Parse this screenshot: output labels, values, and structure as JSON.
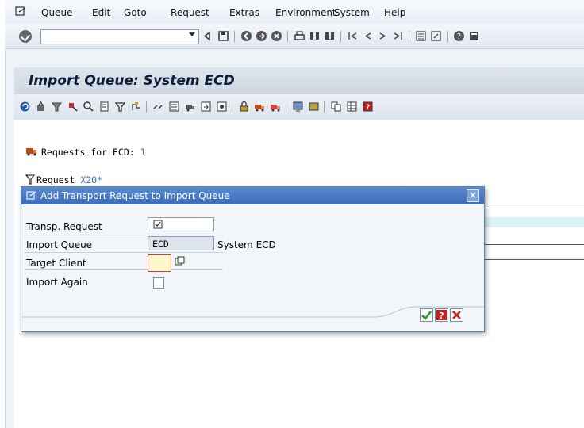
{
  "menubar": {
    "items": [
      {
        "prefix": "",
        "underline": "Q",
        "rest": "ueue"
      },
      {
        "prefix": "",
        "underline": "E",
        "rest": "dit"
      },
      {
        "prefix": "",
        "underline": "G",
        "rest": "oto"
      },
      {
        "prefix": "",
        "underline": "R",
        "rest": "equest"
      },
      {
        "prefix": "Extr",
        "underline": "a",
        "rest": "s"
      },
      {
        "prefix": "En",
        "underline": "v",
        "rest": "ironment"
      },
      {
        "prefix": "S",
        "underline": "y",
        "rest": "stem"
      },
      {
        "prefix": "",
        "underline": "H",
        "rest": "elp"
      }
    ]
  },
  "toolbar": {
    "command_value": ""
  },
  "page": {
    "title": "Import Queue: System ECD"
  },
  "content": {
    "requests_label": "Requests for ECD: ",
    "requests_count": "1",
    "filter_label": "Request ",
    "filter_value": "X20*"
  },
  "dialog": {
    "title": "Add Transport Request to Import Queue",
    "fields": [
      {
        "label": "Transp. Request",
        "value": ""
      },
      {
        "label": "Import Queue",
        "value": "ECD",
        "desc": "System ECD"
      },
      {
        "label": "Target Client",
        "value": ""
      },
      {
        "label": "Import Again",
        "checked": false
      }
    ]
  },
  "colors": {
    "accent": "#3c6bb8",
    "ok": "#2e9b2e",
    "cancel": "#c81e1e"
  }
}
